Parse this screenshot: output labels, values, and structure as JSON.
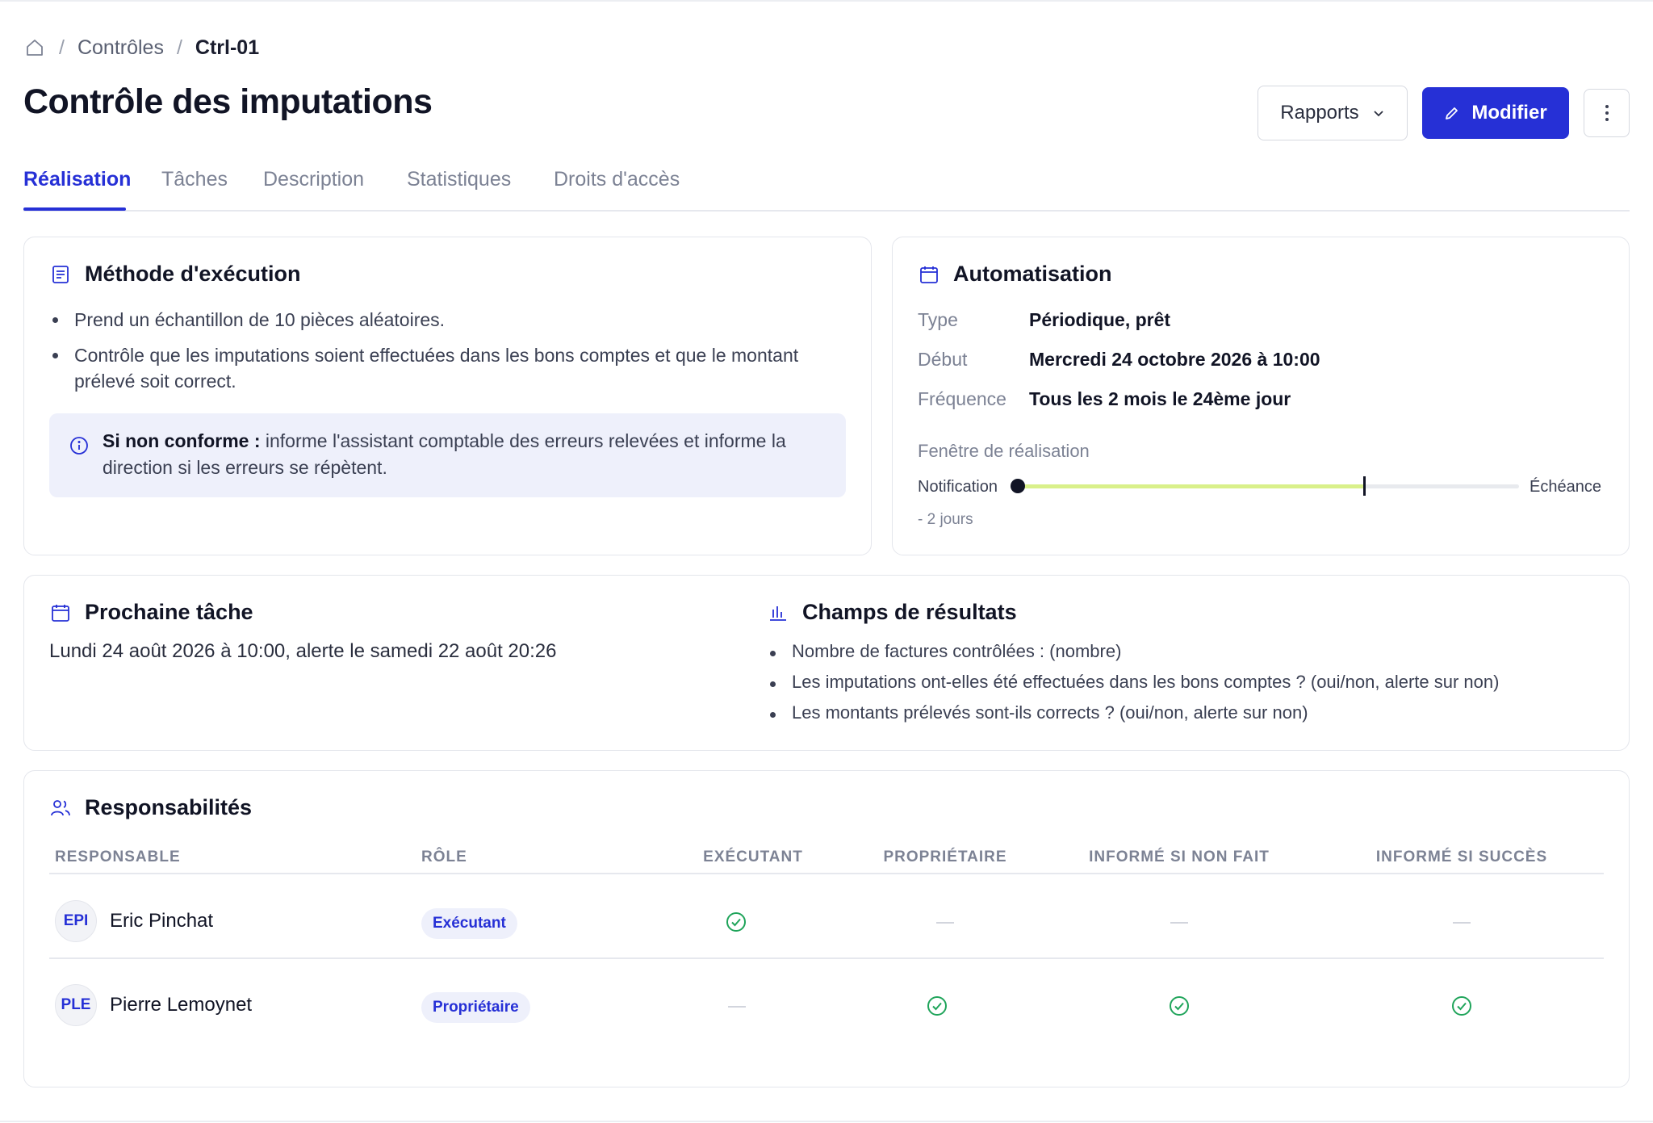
{
  "breadcrumb": {
    "home_icon": "home-icon",
    "items": [
      "Contrôles",
      "Ctrl-01"
    ]
  },
  "page": {
    "title": "Contrôle des imputations"
  },
  "actions": {
    "rapports_label": "Rapports",
    "modifier_label": "Modifier",
    "accent_color": "#2630d6"
  },
  "tabs": [
    {
      "label": "Réalisation",
      "active": true
    },
    {
      "label": "Tâches",
      "active": false
    },
    {
      "label": "Description",
      "active": false
    },
    {
      "label": "Statistiques",
      "active": false
    },
    {
      "label": "Droits d'accès",
      "active": false
    }
  ],
  "methode": {
    "title": "Méthode d'exécution",
    "items": [
      "Prend un échantillon de 10 pièces aléatoires.",
      "Contrôle que les imputations soient effectuées dans les bons comptes et que le montant prélevé soit correct."
    ],
    "callout_strong": "Si non conforme :",
    "callout_text": " informe l'assistant comptable des erreurs relevées et informe la direction si les erreurs se répètent."
  },
  "automatisation": {
    "title": "Automatisation",
    "type_label": "Type",
    "type_value": "Périodique, prêt",
    "debut_label": "Début",
    "debut_value": "Mercredi 24 octobre 2026 à 10:00",
    "frequence_label": "Fréquence",
    "frequence_value": "Tous les 2 mois le 24ème jour",
    "window_label": "Fenêtre de réalisation",
    "notification_label": "Notification",
    "echeance_label": "Échéance",
    "offset_label": "- 2 jours",
    "progress_fraction": 0.69
  },
  "prochaine": {
    "title": "Prochaine tâche",
    "text": "Lundi 24 août 2026 à 10:00, alerte le samedi 22 août 20:26"
  },
  "champs": {
    "title": "Champs de résultats",
    "items": [
      "Nombre de factures contrôlées : (nombre)",
      "Les imputations ont-elles été effectuées dans les bons comptes ? (oui/non, alerte sur non)",
      "Les montants prélevés sont-ils corrects ? (oui/non, alerte sur non)"
    ]
  },
  "responsabilites": {
    "title": "Responsabilités",
    "headers": [
      "RESPONSABLE",
      "RÔLE",
      "EXÉCUTANT",
      "PROPRIÉTAIRE",
      "INFORMÉ SI NON FAIT",
      "INFORMÉ SI SUCCÈS"
    ],
    "rows": [
      {
        "initials": "EPI",
        "name": "Eric Pinchat",
        "role": "Exécutant",
        "executant": true,
        "proprietaire": false,
        "informe_non_fait": false,
        "informe_succes": false
      },
      {
        "initials": "PLE",
        "name": "Pierre Lemoynet",
        "role": "Propriétaire",
        "executant": false,
        "proprietaire": true,
        "informe_non_fait": true,
        "informe_succes": true
      }
    ],
    "check_color": "#1fa45a"
  }
}
